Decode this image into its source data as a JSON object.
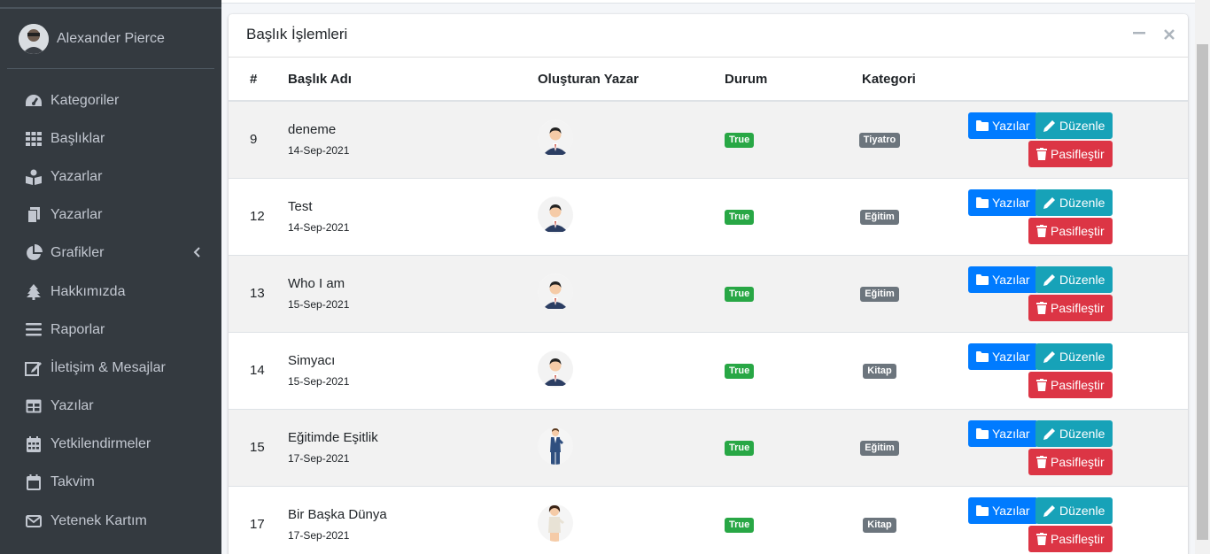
{
  "user": {
    "name": "Alexander Pierce"
  },
  "sidebar": {
    "items": [
      {
        "label": "Kategoriler",
        "icon": "dashboard-gauge-icon"
      },
      {
        "label": "Başlıklar",
        "icon": "grid-icon"
      },
      {
        "label": "Yazarlar",
        "icon": "book-reader-icon"
      },
      {
        "label": "Yazarlar",
        "icon": "copy-icon"
      },
      {
        "label": "Grafikler",
        "icon": "pie-chart-icon",
        "has_chevron": true
      },
      {
        "label": "Hakkımızda",
        "icon": "tree-icon"
      },
      {
        "label": "Raporlar",
        "icon": "bars-icon"
      },
      {
        "label": "İletişim & Mesajlar",
        "icon": "edit-icon"
      },
      {
        "label": "Yazılar",
        "icon": "table-icon"
      },
      {
        "label": "Yetkilendirmeler",
        "icon": "calendar-grid-icon"
      },
      {
        "label": "Takvim",
        "icon": "calendar-icon"
      },
      {
        "label": "Yetenek Kartım",
        "icon": "envelope-icon"
      }
    ]
  },
  "card": {
    "title": "Başlık İşlemleri",
    "columns": [
      "#",
      "Başlık Adı",
      "Oluşturan Yazar",
      "Durum",
      "Kategori"
    ],
    "rows": [
      {
        "id": "9",
        "title": "deneme",
        "date": "14-Sep-2021",
        "author": "man-suit",
        "status": "True",
        "category": "Tiyatro"
      },
      {
        "id": "12",
        "title": "Test",
        "date": "14-Sep-2021",
        "author": "man-suit",
        "status": "True",
        "category": "Eğitim"
      },
      {
        "id": "13",
        "title": "Who I am",
        "date": "15-Sep-2021",
        "author": "man-suit",
        "status": "True",
        "category": "Eğitim"
      },
      {
        "id": "14",
        "title": "Simyacı",
        "date": "15-Sep-2021",
        "author": "man-suit",
        "status": "True",
        "category": "Kitap"
      },
      {
        "id": "15",
        "title": "Eğitimde Eşitlik",
        "date": "17-Sep-2021",
        "author": "man-standing",
        "status": "True",
        "category": "Eğitim"
      },
      {
        "id": "17",
        "title": "Bir Başka Dünya",
        "date": "17-Sep-2021",
        "author": "woman-standing",
        "status": "True",
        "category": "Kitap"
      }
    ],
    "buttons": {
      "posts": "Yazılar",
      "edit": "Düzenle",
      "deactivate": "Pasifleştir"
    }
  },
  "colors": {
    "sidebar": "#343a40",
    "primary": "#007bff",
    "info": "#17a2b8",
    "danger": "#dc3545",
    "success": "#28a745",
    "secondary": "#6c757d"
  }
}
